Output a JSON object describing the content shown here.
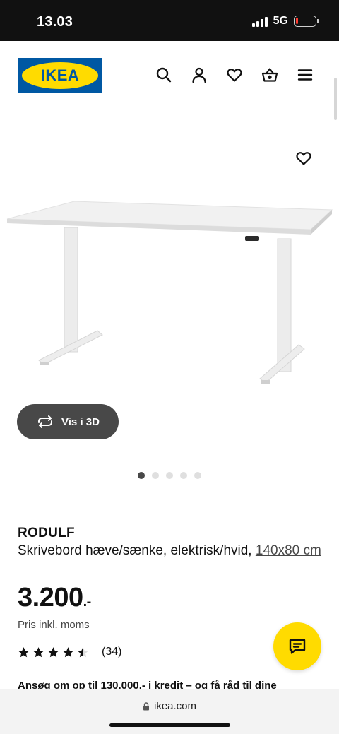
{
  "status_bar": {
    "time": "13.03",
    "network": "5G",
    "battery_level": 0.08
  },
  "header": {
    "logo_text": "IKEA",
    "icons": [
      "search-icon",
      "profile-icon",
      "heart-icon",
      "basket-icon",
      "menu-icon"
    ]
  },
  "gallery": {
    "view_3d_label": "Vis i 3D",
    "image_count": 5,
    "active_index": 0
  },
  "product": {
    "name": "RODULF",
    "description": "Skrivebord hæve/sænke, elektrisk/hvid,",
    "size": "140x80 cm",
    "price": "3.200",
    "price_suffix": ".-",
    "vat_note": "Pris inkl. moms",
    "rating_value": 4.5,
    "rating_count": "(34)",
    "credit_text": "Ansøg om op til 130.000,- i kredit – og få råd til dine"
  },
  "browser": {
    "url": "ikea.com"
  },
  "colors": {
    "ikea_blue": "#0058a3",
    "ikea_yellow": "#ffdb00",
    "dark_button": "#484848"
  }
}
